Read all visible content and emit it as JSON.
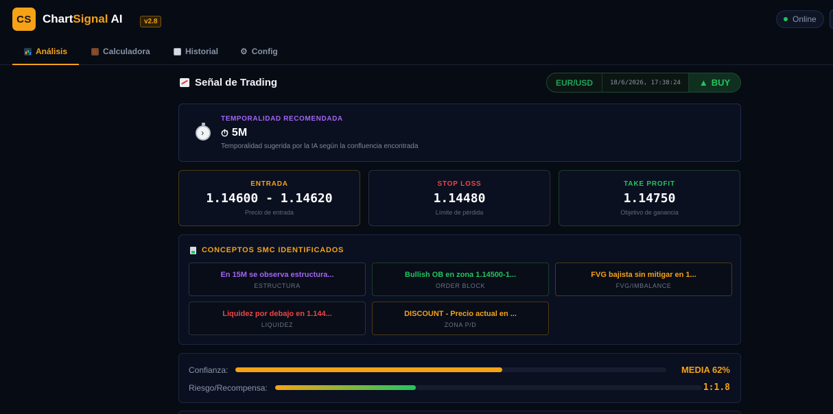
{
  "app": {
    "logo_text": "CS",
    "name_part1": "Chart",
    "name_part2": "Signal",
    "name_part3": " AI",
    "version": "v2.8",
    "status": "Online"
  },
  "nav": {
    "tabs": [
      {
        "label": "Análisis",
        "active": true
      },
      {
        "label": "Calculadora",
        "active": false
      },
      {
        "label": "Historial",
        "active": false
      },
      {
        "label": "Config",
        "active": false
      }
    ]
  },
  "signal": {
    "title": "Señal de Trading",
    "pair": "EUR/USD",
    "timestamp": "18/6/2026, 17:38:24",
    "direction": "BUY",
    "direction_arrow": "▲"
  },
  "timeframe": {
    "label": "TEMPORALIDAD RECOMENDADA",
    "value": "5M",
    "icon": "⏱",
    "description": "Temporalidad sugerida por la IA según la confluencia encontrada"
  },
  "prices": {
    "entry": {
      "label": "ENTRADA",
      "value": "1.14600 - 1.14620",
      "sub": "Precio de entrada",
      "color": "#f5a216"
    },
    "stop_loss": {
      "label": "STOP LOSS",
      "value": "1.14480",
      "sub": "Límite de pérdida",
      "color": "#ef4444"
    },
    "take_profit": {
      "label": "TAKE PROFIT",
      "value": "1.14750",
      "sub": "Objetivo de ganancia",
      "color": "#22c55e"
    }
  },
  "smc": {
    "title": "CONCEPTOS SMC IDENTIFICADOS",
    "concepts": [
      {
        "text": "En 15M se observa estructura...",
        "type": "ESTRUCTURA",
        "color": "#a463f2",
        "border": "#2c2f4d"
      },
      {
        "text": "Bullish OB en zona 1.14500-1...",
        "type": "ORDER BLOCK",
        "color": "#22c55e",
        "border": "#1d3d2b"
      },
      {
        "text": "FVG bajista sin mitigar en 1...",
        "type": "FVG/IMBALANCE",
        "color": "#f5a216",
        "border": "#4a3a14"
      },
      {
        "text": "Liquidez por debajo en 1.144...",
        "type": "LIQUIDEZ",
        "color": "#ef4444",
        "border": "#2a2f3d"
      },
      {
        "text": "DISCOUNT - Precio actual en ...",
        "type": "ZONA P/D",
        "color": "#f5a216",
        "border": "#4a3a14"
      }
    ]
  },
  "metrics": {
    "confidence_label": "Confianza:",
    "confidence_value": "MEDIA 62%",
    "confidence_pct": 62,
    "rr_label": "Riesgo/Recompensa:",
    "rr_value": "1:1.8",
    "rr_pct": 33
  }
}
